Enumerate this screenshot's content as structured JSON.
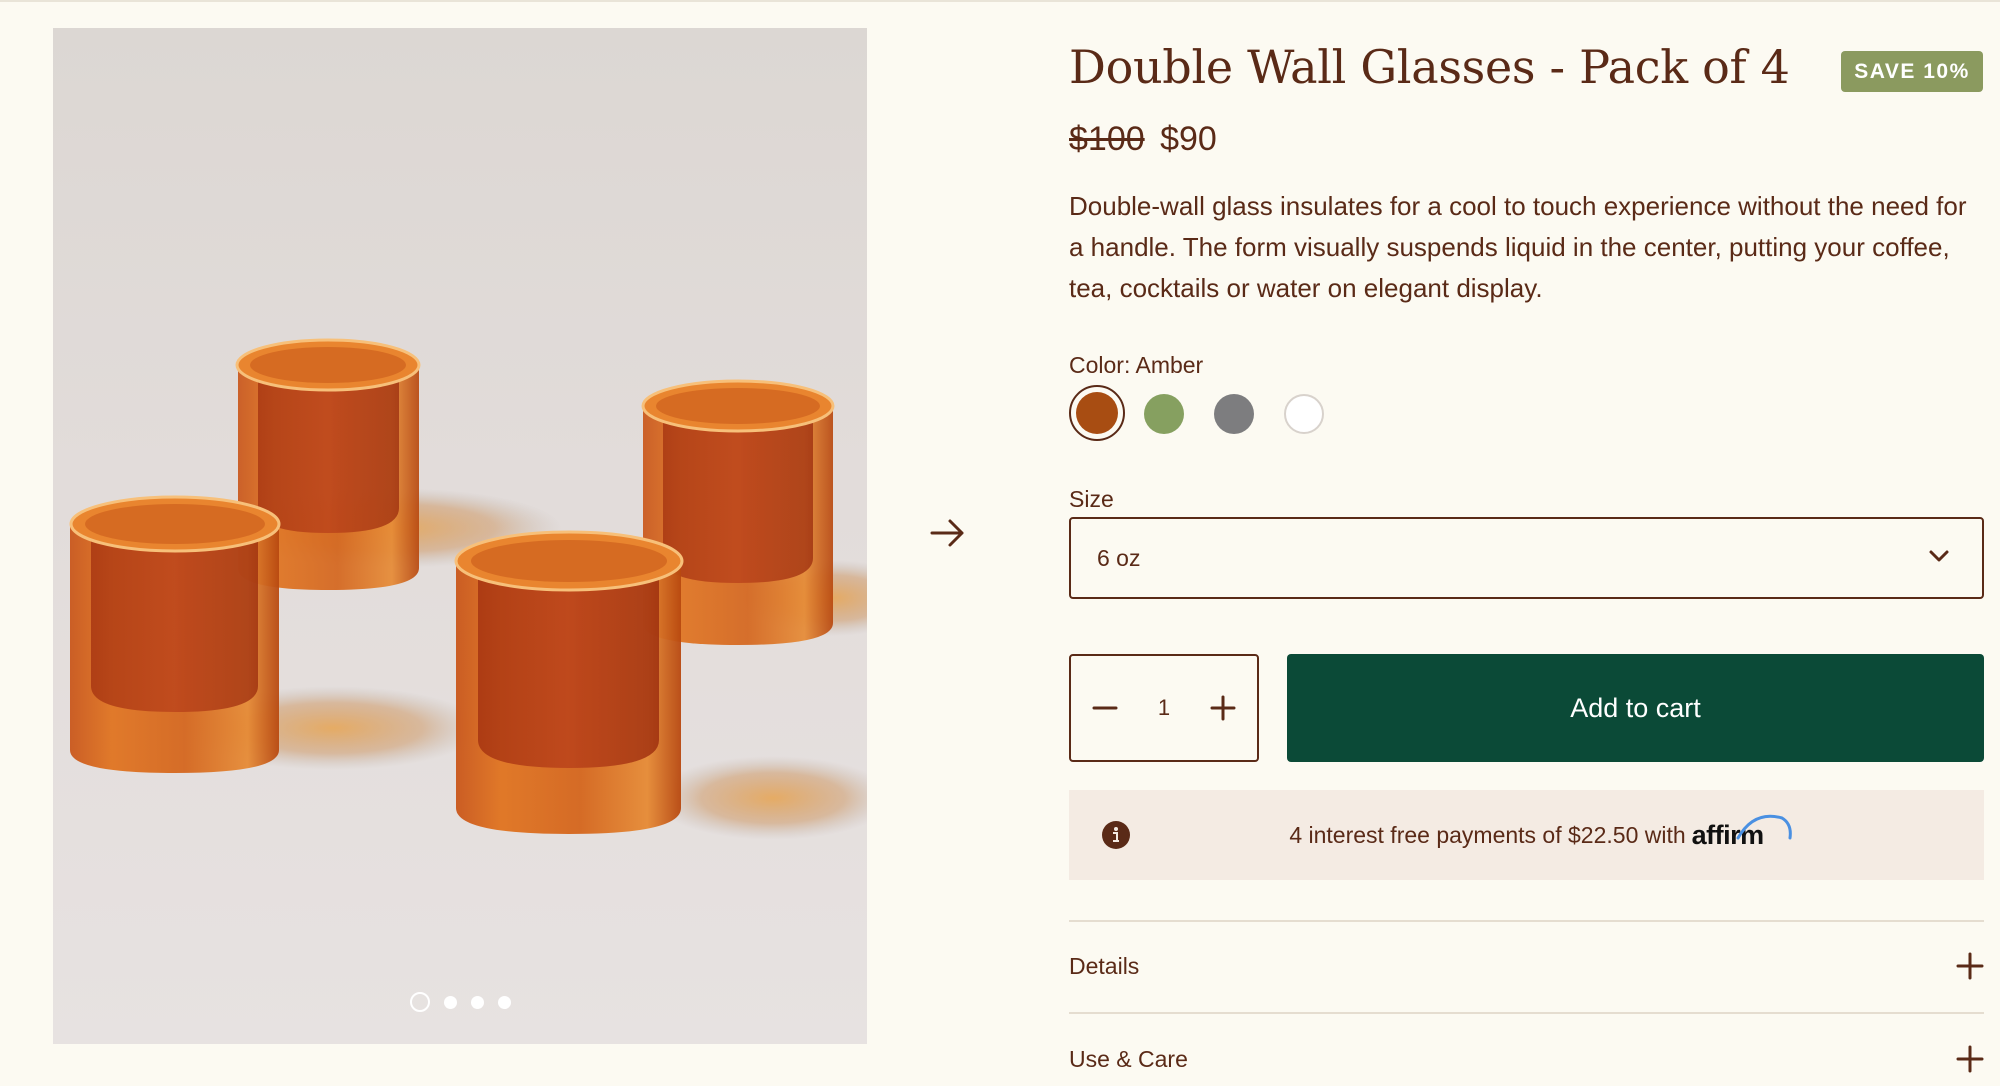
{
  "gallery": {
    "slide_count": 4,
    "active_slide": 1,
    "image_alt": "",
    "next_icon": "arrow-right-icon"
  },
  "product": {
    "title": "Double Wall Glasses - Pack of 4",
    "badge": "SAVE 10%",
    "price_original": "$100",
    "price_sale": "$90",
    "description": "Double-wall glass insulates for a cool to touch experience without the need for a handle. The form visually suspends liquid in the center, putting your coffee, tea, cocktails or water on elegant display."
  },
  "color": {
    "label": "Color: Amber",
    "selected_index": 0,
    "swatches": [
      {
        "name": "Amber",
        "hex": "#a84d12"
      },
      {
        "name": "Green",
        "hex": "#86a060"
      },
      {
        "name": "Grey",
        "hex": "#7d7d7f"
      },
      {
        "name": "Clear",
        "hex": "#ffffff"
      }
    ]
  },
  "size": {
    "label": "Size",
    "selected": "6 oz",
    "icon": "chevron-down-icon"
  },
  "purchase": {
    "quantity": "1",
    "add_to_cart": "Add to cart"
  },
  "affirm": {
    "text": "4 interest free payments of $22.50 with",
    "logo": "affirm",
    "icon": "info-icon"
  },
  "accordion": [
    {
      "label": "Details",
      "icon": "plus-icon"
    },
    {
      "label": "Use & Care",
      "icon": "plus-icon"
    }
  ],
  "colors": {
    "background": "#fcfaf2",
    "text": "#5a2a17",
    "cta": "#0b4a37",
    "badge": "#8b9a5f",
    "affirm_bg": "#f4ebe3"
  }
}
